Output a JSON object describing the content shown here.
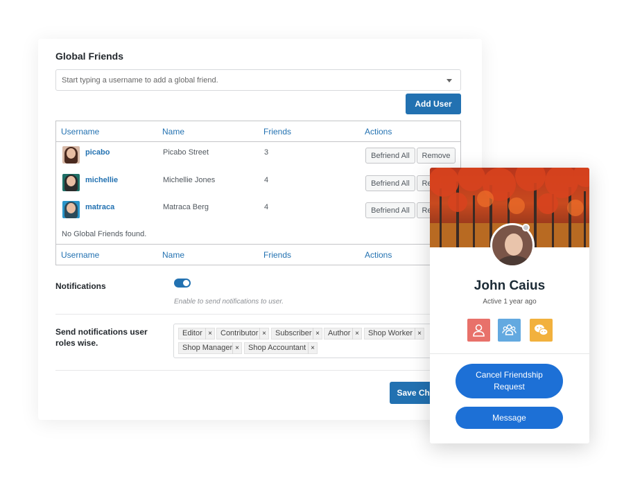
{
  "global_friends": {
    "title": "Global Friends",
    "search_placeholder": "Start typing a username to add a global friend.",
    "add_user_label": "Add User"
  },
  "table": {
    "headers": [
      "Username",
      "Name",
      "Friends",
      "Actions"
    ],
    "rows": [
      {
        "username": "picabo",
        "name": "Picabo Street",
        "friends": "3",
        "befriend": "Befriend All",
        "remove": "Remove"
      },
      {
        "username": "michellie",
        "name": "Michellie Jones",
        "friends": "4",
        "befriend": "Befriend All",
        "remove": "Remove"
      },
      {
        "username": "matraca",
        "name": "Matraca Berg",
        "friends": "4",
        "befriend": "Befriend All",
        "remove": "Remove"
      }
    ],
    "empty_text": "No Global Friends found."
  },
  "notifications": {
    "label": "Notifications",
    "enabled": true,
    "hint": "Enable to send notifications to user."
  },
  "roles": {
    "label": "Send notifications user roles wise.",
    "tags": [
      "Editor",
      "Contributor",
      "Subscriber",
      "Author",
      "Shop Worker",
      "Shop Manager",
      "Shop Accountant"
    ],
    "remove_glyph": "×"
  },
  "save_label": "Save Changes",
  "profile_card": {
    "name": "John Caius",
    "activity": "Active 1 year ago",
    "icons": [
      "profile-icon",
      "group-icon",
      "wechat-icon"
    ],
    "colors": {
      "profile": "#e8716a",
      "group": "#63a9e0",
      "wechat": "#f2b13d",
      "accent": "#1d70d6"
    },
    "cancel_label": "Cancel Friendship Request",
    "message_label": "Message"
  }
}
